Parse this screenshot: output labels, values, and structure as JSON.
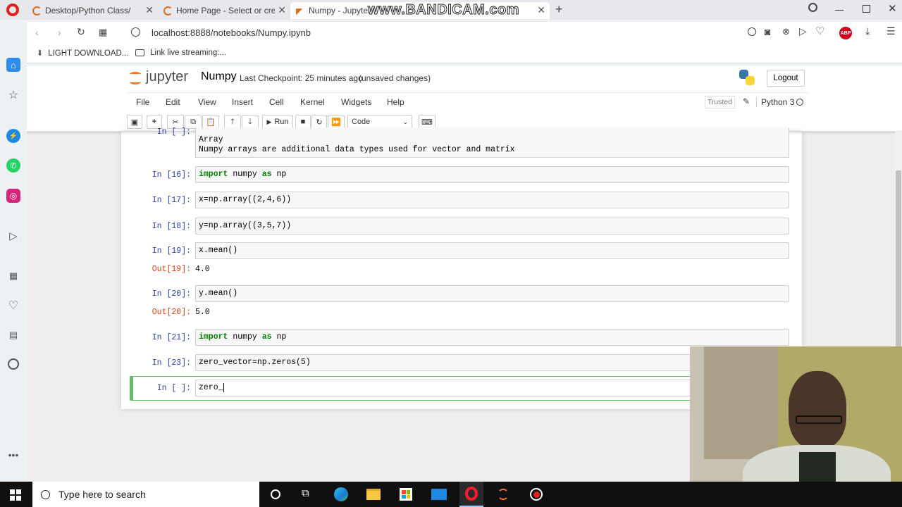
{
  "browser": {
    "tabs": [
      {
        "title": "Desktop/Python Class/"
      },
      {
        "title": "Home Page - Select or crea"
      },
      {
        "title": "Numpy - Jupyter"
      }
    ],
    "url": "localhost:8888/notebooks/Numpy.ipynb",
    "bookmarks": [
      {
        "label": "LIGHT DOWNLOAD..."
      },
      {
        "label": "Link live streaming:..."
      }
    ],
    "watermark": "www.BANDICAM.com",
    "abp": "ABP"
  },
  "jupyter": {
    "logo_text": "jupyter",
    "notebook_name": "Numpy",
    "checkpoint": "Last Checkpoint: 25 minutes ago",
    "save_status": "(unsaved changes)",
    "logout": "Logout",
    "menu": [
      "File",
      "Edit",
      "View",
      "Insert",
      "Cell",
      "Kernel",
      "Widgets",
      "Help"
    ],
    "trusted": "Trusted",
    "kernel": "Python 3",
    "run_label": "Run",
    "cell_type": "Code"
  },
  "cells": {
    "top_lines": [
      "Array",
      "Numpy arrays are additional data types used for vector and matrix"
    ],
    "c16": {
      "prompt": "In [16]:",
      "code": "import numpy as np"
    },
    "c17": {
      "prompt": "In [17]:",
      "code": "x=np.array((2,4,6))"
    },
    "c18": {
      "prompt": "In [18]:",
      "code": "y=np.array((3,5,7))"
    },
    "c19": {
      "prompt": "In [19]:",
      "code": "x.mean()",
      "out_prompt": "Out[19]:",
      "out": "4.0"
    },
    "c20": {
      "prompt": "In [20]:",
      "code": "y.mean()",
      "out_prompt": "Out[20]:",
      "out": "5.0"
    },
    "c21": {
      "prompt": "In [21]:",
      "code": "import numpy as np"
    },
    "c23": {
      "prompt": "In [23]:",
      "code": "zero_vector=np.zeros(5)"
    },
    "cur": {
      "prompt": "In [ ]:",
      "code": "zero_"
    }
  },
  "taskbar": {
    "search_placeholder": "Type here to search"
  },
  "colors": {
    "jupyter_orange": "#f37626",
    "prompt_in": "#303f9f",
    "prompt_out": "#d84315",
    "selected_cell": "#66bb6a"
  }
}
